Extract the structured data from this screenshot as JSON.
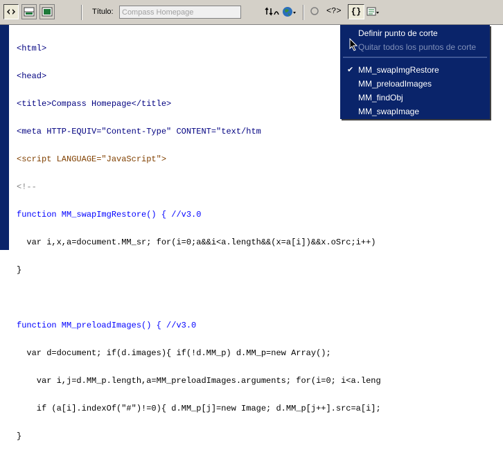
{
  "toolbar": {
    "code_view_icon": "code-view-icon",
    "split_view_icon": "split-view-icon",
    "design_view_icon": "design-view-icon",
    "title_label": "Título:",
    "title_value": "Compass Homepage",
    "file_mgmt_icon": "file-management-icon",
    "preview_icon": "globe-icon",
    "refresh_icon": "refresh-icon",
    "reference_label": "<?>",
    "braces_label": "{}",
    "view_options_icon": "view-options-icon"
  },
  "code": {
    "lines": [
      "<html>",
      "<head>",
      "<title>Compass Homepage</title>",
      "<meta HTTP-EQUIV=\"Content-Type\" CONTENT=\"text/htm",
      "<script LANGUAGE=\"JavaScript\">",
      "<!--",
      "function MM_swapImgRestore() { //v3.0",
      "  var i,x,a=document.MM_sr; for(i=0;a&&i<a.length&&(x=a[i])&&x.oSrc;i++)",
      "}",
      "",
      "function MM_preloadImages() { //v3.0",
      "  var d=document; if(d.images){ if(!d.MM_p) d.MM_p=new Array();",
      "    var i,j=d.MM_p.length,a=MM_preloadImages.arguments; for(i=0; i<a.leng",
      "    if (a[i].indexOf(\"#\")!=0){ d.MM_p[j]=new Image; d.MM_p[j++].src=a[i];",
      "}"
    ]
  },
  "menu": {
    "items": [
      {
        "label": "Definir punto de corte",
        "enabled": true,
        "checked": false
      },
      {
        "label": "Quitar todos los puntos de corte",
        "enabled": false,
        "checked": false
      },
      {
        "label": "MM_swapImgRestore",
        "enabled": true,
        "checked": true
      },
      {
        "label": "MM_preloadImages",
        "enabled": true,
        "checked": false
      },
      {
        "label": "MM_findObj",
        "enabled": true,
        "checked": false
      },
      {
        "label": "MM_swapImage",
        "enabled": true,
        "checked": false
      }
    ],
    "check_mark": "✔"
  },
  "colors": {
    "menu_bg": "#0a246a",
    "gutter": "#0a246a",
    "toolbar_bg": "#d4d0c8",
    "keyword": "#0000ff",
    "tag": "#000080"
  }
}
